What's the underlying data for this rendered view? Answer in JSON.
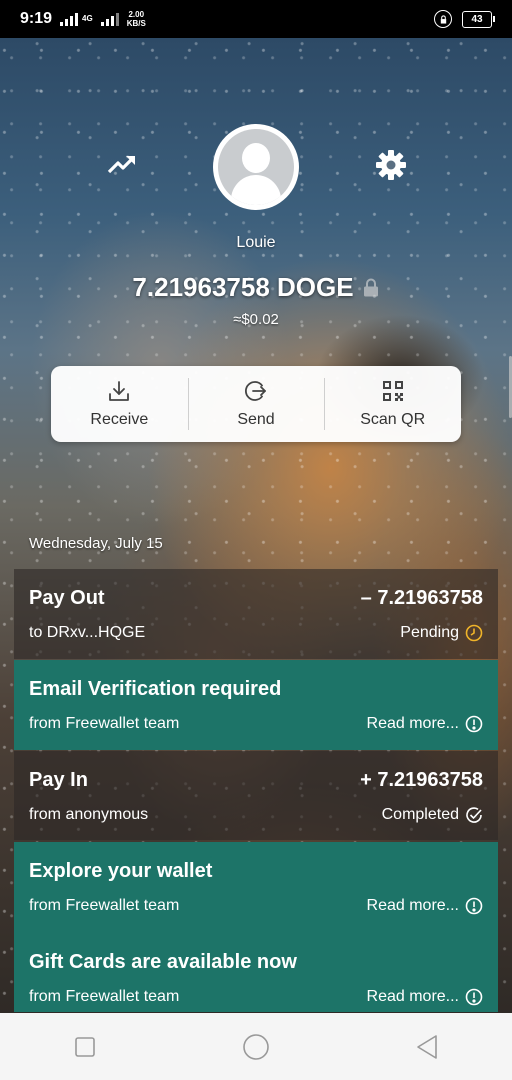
{
  "status_bar": {
    "time": "9:19",
    "network": "4G",
    "speed_value": "2.00",
    "speed_unit": "KB/S",
    "battery": "43"
  },
  "wallet": {
    "username": "Louie",
    "balance": "7.21963758 DOGE",
    "fiat": "≈$0.02"
  },
  "actions": [
    {
      "label": "Receive",
      "icon": "download-icon"
    },
    {
      "label": "Send",
      "icon": "send-icon"
    },
    {
      "label": "Scan QR",
      "icon": "qr-code-icon"
    }
  ],
  "feed": {
    "date": "Wednesday, July 15",
    "items": [
      {
        "kind": "tx",
        "title": "Pay Out",
        "amount": "– 7.21963758",
        "sub": "to DRxv...HQGE",
        "status": "Pending",
        "status_icon": "clock-icon"
      },
      {
        "kind": "msg",
        "title": "Email Verification required",
        "sub": "from Freewallet team",
        "status": "Read more...",
        "status_icon": "info-icon"
      },
      {
        "kind": "tx",
        "title": "Pay In",
        "amount": "+ 7.21963758",
        "sub": "from anonymous",
        "status": "Completed",
        "status_icon": "check-circle-icon"
      },
      {
        "kind": "msg",
        "title": "Explore your wallet",
        "sub": "from Freewallet team",
        "status": "Read more...",
        "status_icon": "info-icon"
      },
      {
        "kind": "msg",
        "title": "Gift Cards are available now",
        "sub": "from Freewallet team",
        "status": "Read more...",
        "status_icon": "info-icon"
      }
    ]
  },
  "colors": {
    "message_bg": "#1d7468",
    "pending_icon": "#f0b429"
  }
}
